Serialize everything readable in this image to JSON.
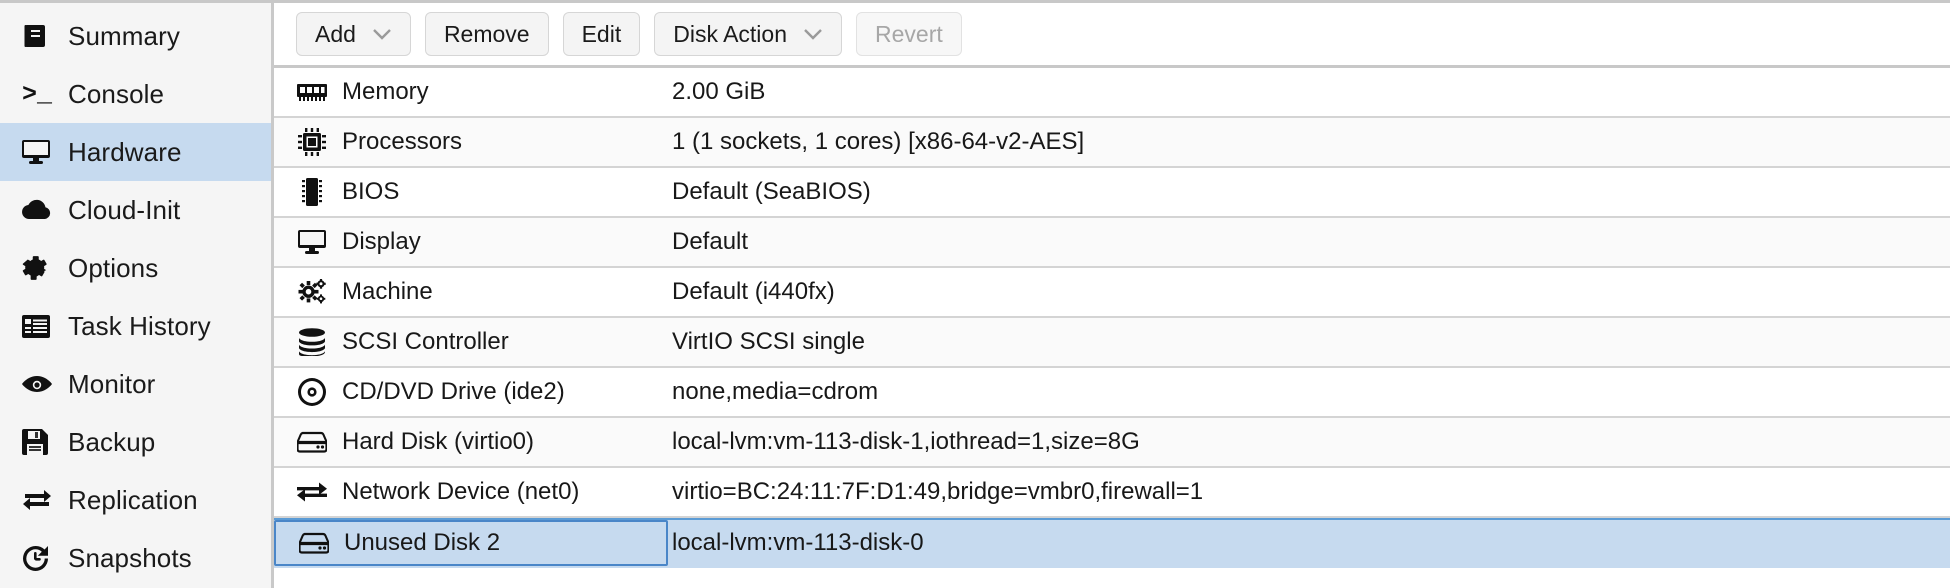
{
  "sidebar": {
    "items": [
      {
        "label": "Summary",
        "icon": "book-icon",
        "selected": false
      },
      {
        "label": "Console",
        "icon": "terminal-icon",
        "selected": false
      },
      {
        "label": "Hardware",
        "icon": "monitor-icon",
        "selected": true
      },
      {
        "label": "Cloud-Init",
        "icon": "cloud-icon",
        "selected": false
      },
      {
        "label": "Options",
        "icon": "gear-icon",
        "selected": false
      },
      {
        "label": "Task History",
        "icon": "list-icon",
        "selected": false
      },
      {
        "label": "Monitor",
        "icon": "eye-icon",
        "selected": false
      },
      {
        "label": "Backup",
        "icon": "floppy-disk-icon",
        "selected": false
      },
      {
        "label": "Replication",
        "icon": "replication-icon",
        "selected": false
      },
      {
        "label": "Snapshots",
        "icon": "history-icon",
        "selected": false
      }
    ]
  },
  "toolbar": {
    "buttons": [
      {
        "label": "Add",
        "has_caret": true,
        "disabled": false
      },
      {
        "label": "Remove",
        "has_caret": false,
        "disabled": false
      },
      {
        "label": "Edit",
        "has_caret": false,
        "disabled": false
      },
      {
        "label": "Disk Action",
        "has_caret": true,
        "disabled": false
      },
      {
        "label": "Revert",
        "has_caret": false,
        "disabled": true
      }
    ]
  },
  "hardware": {
    "rows": [
      {
        "name": "Memory",
        "value": "2.00 GiB",
        "icon": "memory-icon",
        "selected": false
      },
      {
        "name": "Processors",
        "value": "1 (1 sockets, 1 cores) [x86-64-v2-AES]",
        "icon": "cpu-icon",
        "selected": false
      },
      {
        "name": "BIOS",
        "value": "Default (SeaBIOS)",
        "icon": "bios-chip-icon",
        "selected": false
      },
      {
        "name": "Display",
        "value": "Default",
        "icon": "monitor-icon",
        "selected": false
      },
      {
        "name": "Machine",
        "value": "Default (i440fx)",
        "icon": "gears-icon",
        "selected": false
      },
      {
        "name": "SCSI Controller",
        "value": "VirtIO SCSI single",
        "icon": "database-icon",
        "selected": false
      },
      {
        "name": "CD/DVD Drive (ide2)",
        "value": "none,media=cdrom",
        "icon": "disc-icon",
        "selected": false
      },
      {
        "name": "Hard Disk (virtio0)",
        "value": "local-lvm:vm-113-disk-1,iothread=1,size=8G",
        "icon": "hard-drive-icon",
        "selected": false
      },
      {
        "name": "Network Device (net0)",
        "value": "virtio=BC:24:11:7F:D1:49,bridge=vmbr0,firewall=1",
        "icon": "network-icon",
        "selected": false
      },
      {
        "name": "Unused Disk 2",
        "value": "local-lvm:vm-113-disk-0",
        "icon": "hard-drive-icon",
        "selected": true
      }
    ]
  },
  "colors": {
    "selection_blue": "#c6daef",
    "selection_border": "#4a86c8",
    "row_alt": "#fafafa",
    "sidebar_bg": "#f5f5f5",
    "border_gray": "#d4d4d4",
    "disabled_text": "#a7a7a7"
  }
}
